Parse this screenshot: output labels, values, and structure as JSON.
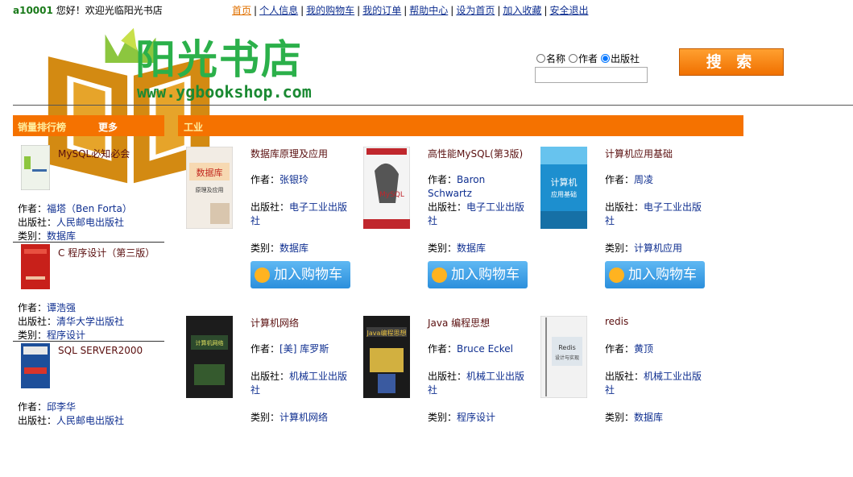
{
  "header": {
    "user_id": "a10001",
    "welcome": "您好！欢迎光临阳光书店",
    "nav": [
      "首页",
      "个人信息",
      "我的购物车",
      "我的订单",
      "帮助中心",
      "设为首页",
      "加入收藏",
      "安全退出"
    ],
    "logo_title": "阳光书店",
    "logo_url": "www.ygbookshop.com"
  },
  "search": {
    "options": [
      "名称",
      "作者",
      "出版社"
    ],
    "selected": "出版社",
    "input_value": "",
    "button_label": "搜 索"
  },
  "sidebar": {
    "title": "销量排行榜",
    "more": "更多",
    "author_label": "作者：",
    "publisher_label": "出版社：",
    "category_label": "类别：",
    "items": [
      {
        "name": "MySQL必知必会",
        "author": "福塔（Ben Forta）",
        "publisher": "人民邮电出版社",
        "category": "数据库"
      },
      {
        "name": "C 程序设计（第三版）",
        "author": "谭浩强",
        "publisher": "清华大学出版社",
        "category": "程序设计"
      },
      {
        "name": "SQL SERVER2000",
        "author": "邱李华",
        "publisher": "人民邮电出版社",
        "category": ""
      }
    ]
  },
  "main": {
    "category_title": "工业",
    "author_label": "作者：",
    "publisher_label": "出版社：",
    "category_label": "类别：",
    "cart_label": "加入购物车",
    "books": [
      {
        "name": "数据库原理及应用",
        "author": "张银玲",
        "publisher": "电子工业出版社",
        "category": "数据库",
        "cover_text": "数据库\n原理及应用"
      },
      {
        "name": "高性能MySQL(第3版)",
        "author": "Baron Schwartz",
        "publisher": "电子工业出版社",
        "category": "数据库",
        "cover_text": "高性能\nMySQL"
      },
      {
        "name": "计算机应用基础",
        "author": "周凌",
        "publisher": "电子工业出版社",
        "category": "计算机应用",
        "cover_text": "计算机\n应用基础"
      },
      {
        "name": "计算机网络",
        "author": "[美] 库罗斯",
        "publisher": "机械工业出版社",
        "category": "计算机网络",
        "cover_text": "计算机网络"
      },
      {
        "name": "Java 编程思想",
        "author": "Bruce Eckel",
        "publisher": "机械工业出版社",
        "category": "程序设计",
        "cover_text": "Java编程思想"
      },
      {
        "name": "redis",
        "author": "黄顶",
        "publisher": "机械工业出版社",
        "category": "数据库",
        "cover_text": "Redis\n设计与实现"
      }
    ]
  },
  "colors": {
    "accent": "#f57200",
    "link": "#0f2f90",
    "title": "#5a0f0f",
    "logo_green": "#2bb04a",
    "cart_blue": "#2b8fdc"
  }
}
